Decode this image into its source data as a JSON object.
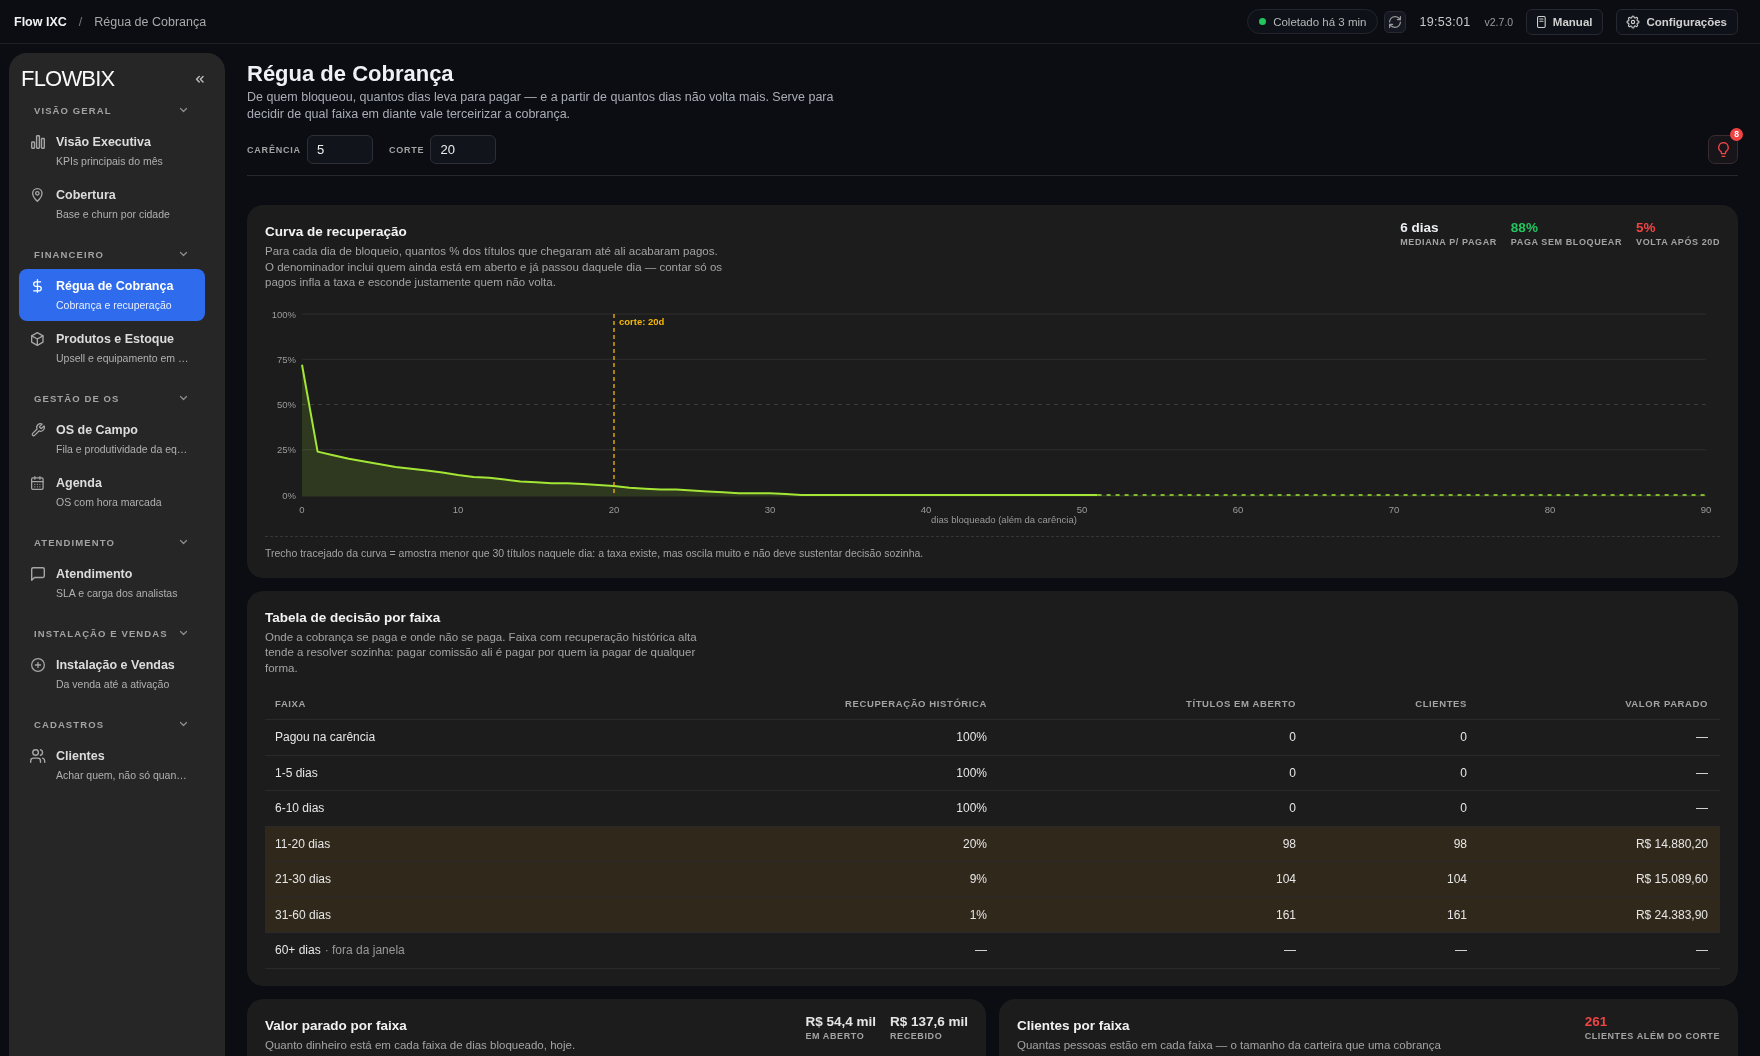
{
  "topbar": {
    "breadcrumb": [
      "Flow IXC",
      "Régua de Cobrança"
    ],
    "separator": "/",
    "status": {
      "label": "Coletado há 3 min",
      "color": "#22c55e"
    },
    "time": "19:53:01",
    "version": "v2.7.0",
    "buttons": [
      "Manual",
      "Configurações"
    ]
  },
  "sidebar": {
    "logo": "FLOWBIX",
    "sections": [
      {
        "title": "VISÃO GERAL",
        "expanded": true,
        "items": [
          {
            "label": "Visão Executiva",
            "description": "KPIs principais do mês",
            "selected": false
          },
          {
            "label": "Cobertura",
            "description": "Base e churn por cidade",
            "selected": false
          }
        ]
      },
      {
        "title": "FINANCEIRO",
        "expanded": true,
        "items": [
          {
            "label": "Régua de Cobrança",
            "description": "Cobrança e recuperação",
            "selected": true
          },
          {
            "label": "Produtos e Estoque",
            "description": "Upsell e equipamento em …",
            "selected": false
          }
        ]
      },
      {
        "title": "GESTÃO DE OS",
        "expanded": true,
        "items": [
          {
            "label": "OS de Campo",
            "description": "Fila e produtividade da eq…",
            "selected": false
          },
          {
            "label": "Agenda",
            "description": "OS com hora marcada",
            "selected": false
          }
        ]
      },
      {
        "title": "ATENDIMENTO",
        "expanded": true,
        "items": [
          {
            "label": "Atendimento",
            "description": "SLA e carga dos analistas",
            "selected": false
          }
        ]
      },
      {
        "title": "INSTALAÇÃO E VENDAS",
        "expanded": true,
        "items": [
          {
            "label": "Instalação e Vendas",
            "description": "Da venda até a ativação",
            "selected": false
          }
        ]
      },
      {
        "title": "CADASTROS",
        "expanded": true,
        "items": [
          {
            "label": "Clientes",
            "description": "Achar quem, não só quan…",
            "selected": false
          }
        ]
      }
    ]
  },
  "page": {
    "title": "Régua de Cobrança",
    "description": "De quem bloqueou, quantos dias leva para pagar — e a partir de quantos dias não volta mais. Serve para decidir de qual faixa em diante vale terceirizar a cobrança.",
    "filters": [
      {
        "label": "CARÊNCIA",
        "value": "5"
      },
      {
        "label": "CORTE",
        "value": "20"
      }
    ],
    "alerts": {
      "count": "8"
    }
  },
  "recovery_curve": {
    "title": "Curva de recuperação",
    "description": "Para cada dia de bloqueio, quantos % dos títulos que chegaram até ali acabaram pagos. O denominador inclui quem ainda está em aberto e já passou daquele dia — contar só os pagos infla a taxa e esconde justamente quem não volta.",
    "stats": [
      {
        "value": "6 dias",
        "label": "MEDIANA P/ PAGAR",
        "color": "#eceef2"
      },
      {
        "value": "88%",
        "label": "PAGA SEM BLOQUEAR",
        "color": "#22c55e"
      },
      {
        "value": "5%",
        "label": "VOLTA APÓS 20D",
        "color": "#ef4444"
      }
    ],
    "chart_data": {
      "type": "area",
      "xlabel": "dias bloqueado (além da carência)",
      "x": [
        0,
        1,
        2,
        3,
        4,
        5,
        6,
        7,
        8,
        9,
        10,
        11,
        12,
        13,
        14,
        15,
        16,
        17,
        18,
        19,
        20,
        21,
        22,
        23,
        24,
        25,
        26,
        27,
        28,
        29,
        30,
        31,
        32,
        33,
        34,
        35,
        36,
        37,
        38,
        39,
        40,
        41,
        42,
        43,
        44,
        45,
        46,
        47,
        48,
        49,
        50,
        51,
        52,
        53,
        54,
        55,
        56,
        57,
        58,
        59,
        60,
        61,
        62,
        63,
        64,
        65,
        66,
        67,
        68,
        69,
        70,
        71,
        72,
        73,
        74,
        75,
        76,
        77,
        78,
        79,
        80,
        81,
        82,
        83,
        84,
        85,
        86,
        87,
        88,
        89,
        90
      ],
      "series": [
        {
          "color": "#a3e635",
          "values": [
            72,
            24,
            22,
            20,
            18.5,
            17,
            15.5,
            14.5,
            13.5,
            12.5,
            11,
            10,
            9.5,
            8.5,
            7.5,
            7,
            6.5,
            6.5,
            6,
            5.5,
            5,
            4,
            3.5,
            3,
            3,
            2.5,
            2,
            1.5,
            1,
            1,
            1,
            0.5,
            0,
            0,
            0,
            0,
            0,
            0,
            0,
            0,
            0,
            0,
            0,
            0,
            0,
            0,
            0,
            0,
            0,
            0,
            0,
            0,
            null,
            null,
            null,
            null,
            null,
            null,
            null,
            null,
            null,
            null,
            null,
            null,
            null,
            null,
            null,
            null,
            null,
            null,
            null,
            null,
            null,
            null,
            null,
            null,
            null,
            null,
            null,
            null,
            null,
            null,
            null,
            null,
            null,
            null,
            null,
            null,
            null,
            null,
            null
          ]
        },
        {
          "color": "#a3e635",
          "values": [
            null,
            null,
            null,
            null,
            null,
            null,
            null,
            null,
            null,
            null,
            null,
            null,
            null,
            null,
            null,
            null,
            null,
            null,
            null,
            null,
            null,
            null,
            null,
            null,
            null,
            null,
            null,
            null,
            null,
            null,
            null,
            null,
            null,
            null,
            null,
            null,
            null,
            null,
            null,
            null,
            null,
            null,
            null,
            null,
            null,
            null,
            null,
            null,
            null,
            null,
            null,
            0,
            0,
            0,
            0,
            0,
            0,
            0,
            0,
            0,
            0,
            0,
            0,
            0,
            0,
            0,
            0,
            0,
            0,
            0,
            0,
            0,
            0,
            0,
            0,
            0,
            0,
            0,
            0,
            0,
            0,
            0,
            0,
            0,
            0,
            0,
            0,
            0,
            0,
            0,
            0
          ]
        }
      ],
      "xlim": [
        0,
        90
      ],
      "ylim": [
        0,
        100
      ],
      "xticks": [
        0,
        10,
        20,
        30,
        40,
        50,
        60,
        70,
        80,
        90
      ],
      "yticks": [
        {
          "value": 0,
          "label": "0%"
        },
        {
          "value": 25,
          "label": "25%"
        },
        {
          "value": 50,
          "label": "50%"
        },
        {
          "value": 75,
          "label": "75%"
        },
        {
          "value": 100,
          "label": "100%"
        }
      ],
      "ref_lines": [
        {
          "axis": "y",
          "value": 50,
          "color": "#3a3a3a"
        },
        {
          "axis": "x",
          "value": 20,
          "label": "corte: 20d",
          "color": "#f5b70a"
        }
      ]
    },
    "footnote": "Trecho tracejado da curva = amostra menor que 30 títulos naquele dia: a taxa existe, mas oscila muito e não deve sustentar decisão sozinha."
  },
  "decision_table": {
    "title": "Tabela de decisão por faixa",
    "description": "Onde a cobrança se paga e onde não se paga. Faixa com recuperação histórica alta tende a resolver sozinha: pagar comissão ali é pagar por quem ia pagar de qualquer forma.",
    "columns": [
      "FAIXA",
      "RECUPERAÇÃO HISTÓRICA",
      "TÍTULOS EM ABERTO",
      "CLIENTES",
      "VALOR PARADO"
    ],
    "rows": [
      {
        "cells": [
          "Pagou na carência",
          "100%",
          "0",
          "0",
          "—"
        ],
        "highlighted": false
      },
      {
        "cells": [
          "1-5 dias",
          "100%",
          "0",
          "0",
          "—"
        ],
        "highlighted": false
      },
      {
        "cells": [
          "6-10 dias",
          "100%",
          "0",
          "0",
          "—"
        ],
        "highlighted": false
      },
      {
        "cells": [
          "11-20 dias",
          "20%",
          "98",
          "98",
          "R$ 14.880,20"
        ],
        "highlighted": true
      },
      {
        "cells": [
          "21-30 dias",
          "9%",
          "104",
          "104",
          "R$ 15.089,60"
        ],
        "highlighted": true
      },
      {
        "cells": [
          "31-60 dias",
          "1%",
          "161",
          "161",
          "R$ 24.383,90"
        ],
        "highlighted": true
      },
      {
        "cells": [
          "60+ dias",
          "—",
          "—",
          "—",
          "—"
        ],
        "note": "· fora da janela",
        "highlighted": false
      }
    ]
  },
  "panels": [
    {
      "title": "Valor parado por faixa",
      "description": "Quanto dinheiro está em cada faixa de dias bloqueado, hoje.",
      "stats": [
        {
          "value": "R$ 54,4 mil",
          "label": "EM ABERTO",
          "color": "#e5e5e5"
        },
        {
          "value": "R$ 137,6 mil",
          "label": "RECEBIDO",
          "color": "#e5e5e5"
        }
      ]
    },
    {
      "title": "Clientes por faixa",
      "description": "Quantas pessoas estão em cada faixa — o tamanho da carteira que uma cobrança",
      "stats": [
        {
          "value": "261",
          "label": "CLIENTES ALÉM DO CORTE",
          "color": "#ef4444"
        }
      ]
    }
  ]
}
